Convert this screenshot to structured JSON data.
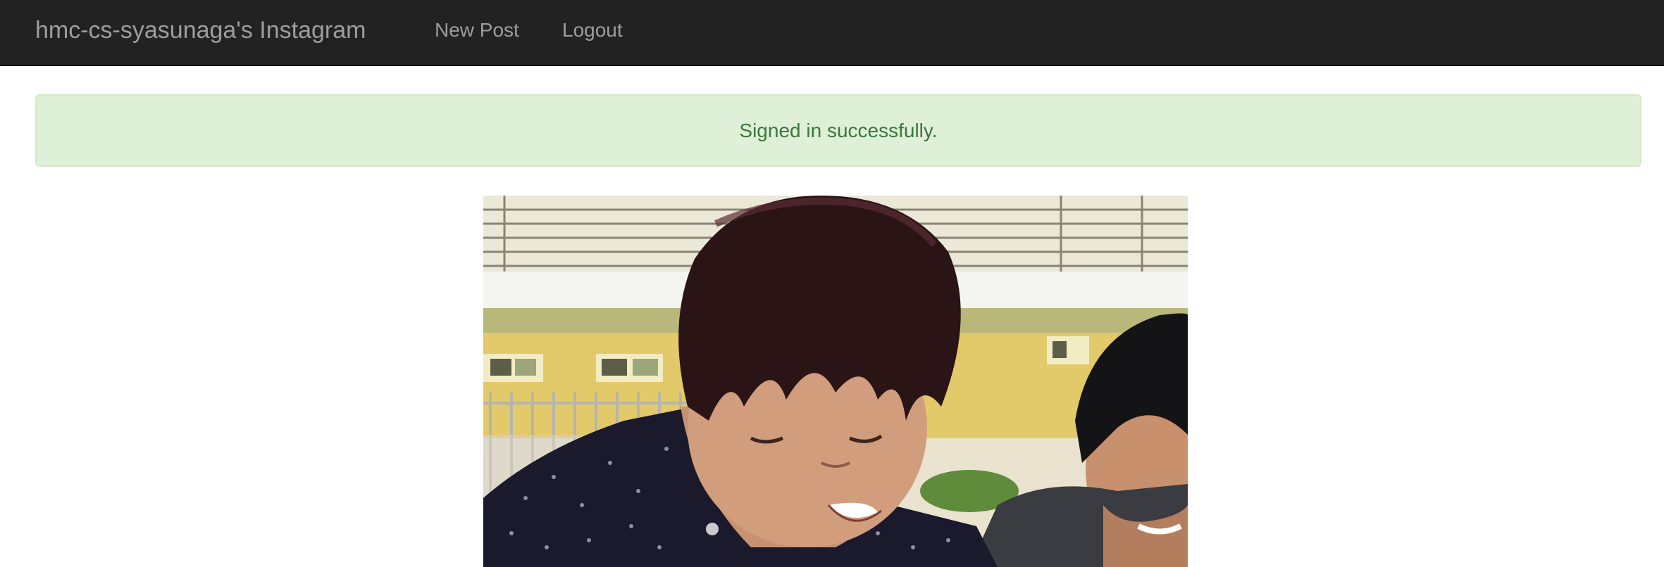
{
  "navbar": {
    "brand": "hmc-cs-syasunaga's Instagram",
    "links": [
      {
        "label": "New Post"
      },
      {
        "label": "Logout"
      }
    ]
  },
  "flash": {
    "message": "Signed in successfully."
  },
  "colors": {
    "navbar_bg": "#222222",
    "nav_text": "#9d9d9d",
    "alert_bg": "#dff0d8",
    "alert_border": "#d6e9c6",
    "alert_text": "#3c763d"
  }
}
